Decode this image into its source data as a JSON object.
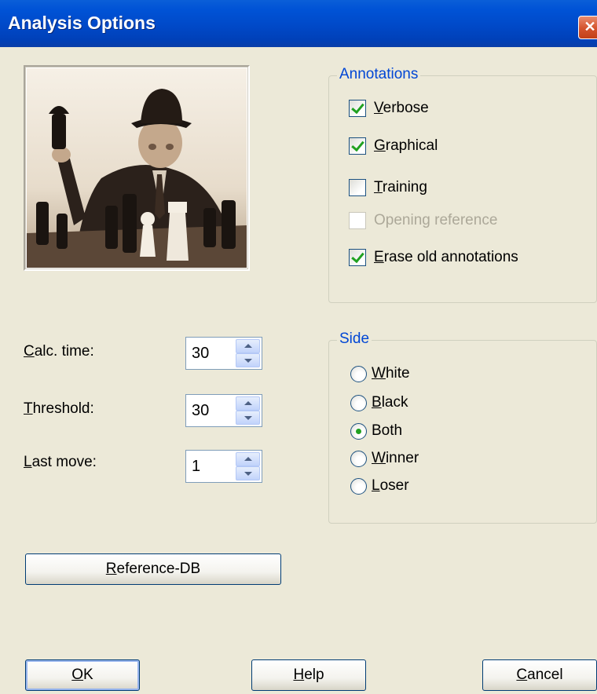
{
  "window": {
    "title": "Analysis Options",
    "close_glyph": "✕"
  },
  "photo": {
    "description_icon": "chess-player-photo"
  },
  "annotations": {
    "legend": "Annotations",
    "items": [
      {
        "label": "Verbose",
        "mnemonic": "V",
        "rest": "erbose",
        "checked": true,
        "enabled": true
      },
      {
        "label": "Graphical",
        "mnemonic": "G",
        "rest": "raphical",
        "checked": true,
        "enabled": true
      },
      {
        "label": "Training",
        "mnemonic": "T",
        "rest": "raining",
        "checked": false,
        "enabled": true
      },
      {
        "label": "Opening reference",
        "checked": false,
        "enabled": false
      },
      {
        "label": "Erase old annotations",
        "mnemonic": "E",
        "rest": "rase old annotations",
        "checked": true,
        "enabled": true
      }
    ]
  },
  "fields": [
    {
      "label": "Calc. time:",
      "mnemonic": "C",
      "rest": "alc. time:",
      "value": "30"
    },
    {
      "label": "Threshold:",
      "mnemonic": "T",
      "rest": "hreshold:",
      "value": "30"
    },
    {
      "label": "Last move:",
      "mnemonic": "L",
      "rest": "ast move:",
      "value": "1"
    }
  ],
  "side": {
    "legend": "Side",
    "options": [
      {
        "label": "White",
        "mnemonic": "W",
        "rest": "hite",
        "selected": false
      },
      {
        "label": "Black",
        "mnemonic": "B",
        "rest": "lack",
        "selected": false
      },
      {
        "label": "Both",
        "mnemonic": "",
        "rest": "Both",
        "selected": true
      },
      {
        "label": "Winner",
        "mnemonic": "W",
        "rest": "inner",
        "selected": false
      },
      {
        "label": "Loser",
        "mnemonic": "L",
        "rest": "oser",
        "selected": false
      }
    ]
  },
  "buttons": {
    "reference": {
      "label": "Reference-DB",
      "mnemonic": "R",
      "rest": "eference-DB"
    },
    "ok": {
      "label": "OK",
      "mnemonic": "O",
      "rest": "K"
    },
    "help": {
      "label": "Help",
      "mnemonic": "H",
      "rest": "elp"
    },
    "cancel": {
      "label": "Cancel",
      "mnemonic": "C",
      "rest": "ancel"
    }
  },
  "colors": {
    "title_bar": "#0049c8",
    "group_legend": "#0046d5",
    "check_mark": "#21a121",
    "dialog_bg": "#ece9d8"
  }
}
